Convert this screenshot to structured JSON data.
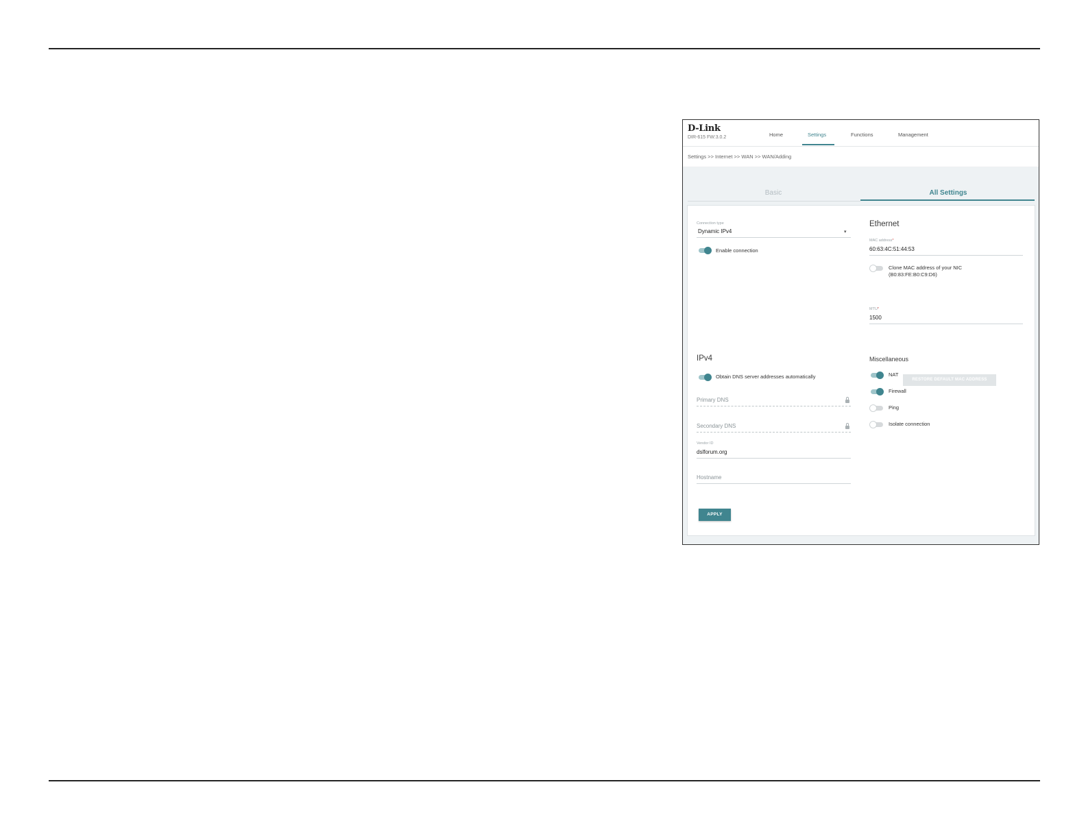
{
  "header": {
    "logo": "D-Link",
    "model": "DIR-615 FW:3.0.2",
    "nav": [
      "Home",
      "Settings",
      "Functions",
      "Management"
    ],
    "active_nav": "Settings"
  },
  "breadcrumb": "Settings >> Internet >> WAN >> WAN/Adding",
  "tabs": {
    "basic": "Basic",
    "all": "All Settings"
  },
  "connection": {
    "type_label": "Connection type",
    "type_value": "Dynamic IPv4",
    "enable_label": "Enable connection",
    "enable_on": true
  },
  "ethernet": {
    "title": "Ethernet",
    "mac_label": "MAC address",
    "mac_value": "60:63:4C:51:44:53",
    "clone_label_1": "Clone MAC address of your NIC",
    "clone_label_2": "(B0:83:FE:B0:C9:D6)",
    "clone_on": false,
    "restore_button": "RESTORE DEFAULT MAC ADDRESS",
    "mtu_label": "MTU",
    "mtu_value": "1500"
  },
  "ipv4": {
    "title": "IPv4",
    "obtain_dns_label": "Obtain DNS server addresses automatically",
    "obtain_dns_on": true,
    "primary_dns_placeholder": "Primary DNS",
    "secondary_dns_placeholder": "Secondary DNS",
    "vendor_label": "Vendor ID",
    "vendor_value": "dslforum.org",
    "hostname_placeholder": "Hostname"
  },
  "misc": {
    "title": "Miscellaneous",
    "items": [
      {
        "label": "NAT",
        "on": true
      },
      {
        "label": "Firewall",
        "on": true
      },
      {
        "label": "Ping",
        "on": false
      },
      {
        "label": "Isolate connection",
        "on": false
      }
    ]
  },
  "apply_button": "APPLY",
  "colors": {
    "accent": "#40858f",
    "background": "#eef2f4"
  }
}
